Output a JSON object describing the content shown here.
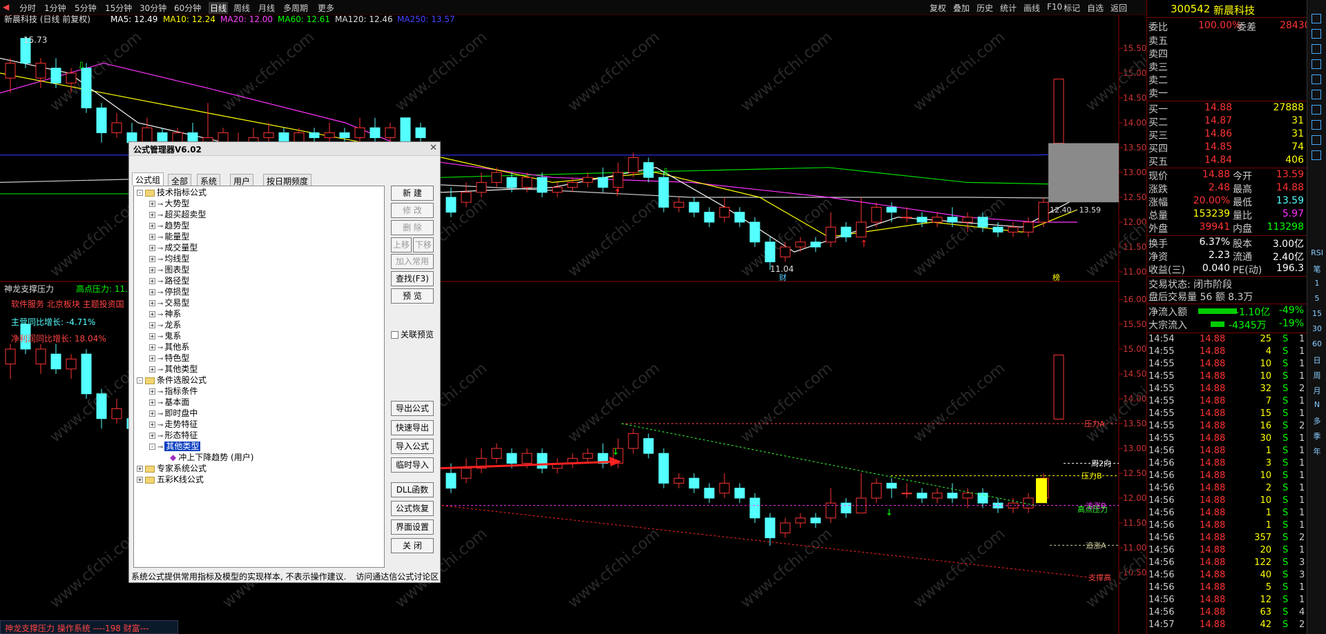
{
  "toolbar": {
    "periods": [
      "分时",
      "1分钟",
      "5分钟",
      "15分钟",
      "30分钟",
      "60分钟",
      "日线",
      "周线",
      "月线",
      "多周期",
      "更多"
    ],
    "active": "日线",
    "right_buttons": [
      "复权",
      "叠加",
      "历史",
      "统计",
      "画线",
      "F10",
      "标记",
      "自选",
      "返回"
    ]
  },
  "main_chart": {
    "title": "新晨科技 (日线 前复权)",
    "ma": [
      {
        "label": "MA5: 12.49",
        "color": "#ffffff"
      },
      {
        "label": "MA10: 12.24",
        "color": "#ffff00"
      },
      {
        "label": "MA20: 12.00",
        "color": "#ff44ff"
      },
      {
        "label": "MA60: 12.61",
        "color": "#00ff00"
      },
      {
        "label": "MA120: 12.46",
        "color": "#dddddd"
      },
      {
        "label": "MA250: 13.57",
        "color": "#4444ff"
      }
    ],
    "high_label": "15.73",
    "low_label": "11.04",
    "range_label": "12.40 - 13.59",
    "axis_labels": [
      "15.50",
      "15.00",
      "14.50",
      "14.00",
      "13.50",
      "13.00",
      "12.50",
      "12.00",
      "11.50",
      "11.00"
    ],
    "marks": [
      "财",
      "榜"
    ]
  },
  "sub_chart": {
    "title": "神龙支撑压力",
    "high_pressure": "高点压力: 11.",
    "sector": "软件服务 北京板块 主题投资国",
    "stat1": "主营同比增长: -4.71%",
    "stat2": "净利润同比增长: 18.04%",
    "axis_labels": [
      "16.00",
      "15.50",
      "15.00",
      "14.50",
      "14.00",
      "13.50",
      "13.00",
      "12.50",
      "12.00",
      "11.50",
      "11.00",
      "10.50"
    ],
    "line_labels": [
      "压力A",
      "周2向",
      "压力B",
      "追涨B",
      "高点压力",
      "追涨A",
      "支撑高"
    ]
  },
  "dialog": {
    "title": "公式管理器V6.02",
    "tabs": [
      "公式组",
      "全部",
      "系统",
      "用户",
      "按日期频度"
    ],
    "tree": [
      {
        "label": "技术指标公式",
        "level": 0,
        "type": "folder",
        "sign": "-"
      },
      {
        "label": "大势型",
        "level": 1,
        "type": "item",
        "sign": "+"
      },
      {
        "label": "超买超卖型",
        "level": 1,
        "type": "item",
        "sign": "+"
      },
      {
        "label": "趋势型",
        "level": 1,
        "type": "item",
        "sign": "+"
      },
      {
        "label": "能量型",
        "level": 1,
        "type": "item",
        "sign": "+"
      },
      {
        "label": "成交量型",
        "level": 1,
        "type": "item",
        "sign": "+"
      },
      {
        "label": "均线型",
        "level": 1,
        "type": "item",
        "sign": "+"
      },
      {
        "label": "图表型",
        "level": 1,
        "type": "item",
        "sign": "+"
      },
      {
        "label": "路径型",
        "level": 1,
        "type": "item",
        "sign": "+"
      },
      {
        "label": "停损型",
        "level": 1,
        "type": "item",
        "sign": "+"
      },
      {
        "label": "交易型",
        "level": 1,
        "type": "item",
        "sign": "+"
      },
      {
        "label": "神系",
        "level": 1,
        "type": "item",
        "sign": "+"
      },
      {
        "label": "龙系",
        "level": 1,
        "type": "item",
        "sign": "+"
      },
      {
        "label": "鬼系",
        "level": 1,
        "type": "item",
        "sign": "+"
      },
      {
        "label": "其他系",
        "level": 1,
        "type": "item",
        "sign": "+"
      },
      {
        "label": "特色型",
        "level": 1,
        "type": "item",
        "sign": "+"
      },
      {
        "label": "其他类型",
        "level": 1,
        "type": "item",
        "sign": "+"
      },
      {
        "label": "条件选股公式",
        "level": 0,
        "type": "folder",
        "sign": "-"
      },
      {
        "label": "指标条件",
        "level": 1,
        "type": "item",
        "sign": "+"
      },
      {
        "label": "基本面",
        "level": 1,
        "type": "item",
        "sign": "+"
      },
      {
        "label": "即时盘中",
        "level": 1,
        "type": "item",
        "sign": "+"
      },
      {
        "label": "走势特征",
        "level": 1,
        "type": "item",
        "sign": "+"
      },
      {
        "label": "形态特征",
        "level": 1,
        "type": "item",
        "sign": "+"
      },
      {
        "label": "其他类型",
        "level": 1,
        "type": "item",
        "sign": "-",
        "selected": true
      },
      {
        "label": "冲上下降趋势    (用户)",
        "level": 2,
        "type": "leaf",
        "sign": ""
      },
      {
        "label": "专家系统公式",
        "level": 0,
        "type": "folder",
        "sign": "+"
      },
      {
        "label": "五彩K线公式",
        "level": 0,
        "type": "folder",
        "sign": "+"
      }
    ],
    "buttons": [
      {
        "label": "新  建",
        "enabled": true
      },
      {
        "label": "修  改",
        "enabled": false
      },
      {
        "label": "删  除",
        "enabled": false
      },
      {
        "label": "上移",
        "enabled": false
      },
      {
        "label": "下移",
        "enabled": false
      },
      {
        "label": "加入常用",
        "enabled": false
      },
      {
        "label": "查找(F3)",
        "enabled": true
      },
      {
        "label": "预  览",
        "enabled": true
      }
    ],
    "preview_checkbox": "关联预览",
    "buttons2": [
      "导出公式",
      "快速导出",
      "导入公式",
      "临时导入",
      "DLL函数",
      "公式恢复",
      "界面设置",
      "关  闭"
    ],
    "footer": "系统公式提供常用指标及模型的实现样本, 不表示操作建议.",
    "footer_link": "访问通达信公式讨论区"
  },
  "quote": {
    "code": "300542",
    "name": "新晨科技",
    "weibi_label": "委比",
    "weibi": "100.00%",
    "weicha_label": "委差",
    "weicha": "28430",
    "sells": [
      "卖五",
      "卖四",
      "卖三",
      "卖二",
      "卖一"
    ],
    "buys": [
      {
        "label": "买一",
        "price": "14.88",
        "vol": "27888"
      },
      {
        "label": "买二",
        "price": "14.87",
        "vol": "31"
      },
      {
        "label": "买三",
        "price": "14.86",
        "vol": "31"
      },
      {
        "label": "买四",
        "price": "14.85",
        "vol": "74"
      },
      {
        "label": "买五",
        "price": "14.84",
        "vol": "406"
      }
    ],
    "stats": [
      [
        "现价",
        "14.88",
        "今开",
        "13.59"
      ],
      [
        "涨跌",
        "2.48",
        "最高",
        "14.88"
      ],
      [
        "涨幅",
        "20.00%",
        "最低",
        "13.59"
      ],
      [
        "总量",
        "153239",
        "量比",
        "5.97"
      ],
      [
        "外盘",
        "39941",
        "内盘",
        "113298"
      ]
    ],
    "stats2": [
      [
        "换手",
        "6.37%",
        "股本",
        "3.00亿"
      ],
      [
        "净资",
        "2.23",
        "流通",
        "2.40亿"
      ],
      [
        "收益(三)",
        "0.040",
        "PE(动)",
        "196.3"
      ]
    ],
    "trade_status": "交易状态: 闭市阶段",
    "after_hours": "盘后交易量 56 额 8.3万",
    "flows": [
      {
        "label": "净流入额",
        "value": "-1.10亿",
        "pct": "-49%"
      },
      {
        "label": "大宗流入",
        "value": "-4345万",
        "pct": "-19%"
      }
    ],
    "ticks": [
      [
        "14:54",
        "14.88",
        "25",
        "S",
        "1"
      ],
      [
        "14:55",
        "14.88",
        "4",
        "S",
        "1"
      ],
      [
        "14:55",
        "14.88",
        "10",
        "S",
        "1"
      ],
      [
        "14:55",
        "14.88",
        "10",
        "S",
        "1"
      ],
      [
        "14:55",
        "14.88",
        "32",
        "S",
        "2"
      ],
      [
        "14:55",
        "14.88",
        "7",
        "S",
        "1"
      ],
      [
        "14:55",
        "14.88",
        "15",
        "S",
        "1"
      ],
      [
        "14:55",
        "14.88",
        "16",
        "S",
        "2"
      ],
      [
        "14:55",
        "14.88",
        "30",
        "S",
        "1"
      ],
      [
        "14:56",
        "14.88",
        "1",
        "S",
        "1"
      ],
      [
        "14:56",
        "14.88",
        "3",
        "S",
        "1"
      ],
      [
        "14:56",
        "14.88",
        "10",
        "S",
        "1"
      ],
      [
        "14:56",
        "14.88",
        "2",
        "S",
        "1"
      ],
      [
        "14:56",
        "14.88",
        "10",
        "S",
        "1"
      ],
      [
        "14:56",
        "14.88",
        "1",
        "S",
        "1"
      ],
      [
        "14:56",
        "14.88",
        "1",
        "S",
        "1"
      ],
      [
        "14:56",
        "14.88",
        "357",
        "S",
        "2"
      ],
      [
        "14:56",
        "14.88",
        "20",
        "S",
        "1"
      ],
      [
        "14:56",
        "14.88",
        "122",
        "S",
        "3"
      ],
      [
        "14:56",
        "14.88",
        "40",
        "S",
        "3"
      ],
      [
        "14:56",
        "14.88",
        "5",
        "S",
        "1"
      ],
      [
        "14:56",
        "14.88",
        "12",
        "S",
        "1"
      ],
      [
        "14:56",
        "14.88",
        "63",
        "S",
        "4"
      ],
      [
        "14:57",
        "14.88",
        "42",
        "S",
        "2"
      ]
    ]
  },
  "side_icons": [
    "RSI",
    "笔",
    "1",
    "5",
    "15",
    "30",
    "60",
    "日",
    "周",
    "月",
    "N",
    "多",
    "季",
    "年"
  ],
  "statusbar": "神龙支撑压力 操作系统 ----198 财富---",
  "watermark": "www.cfchi.com"
}
